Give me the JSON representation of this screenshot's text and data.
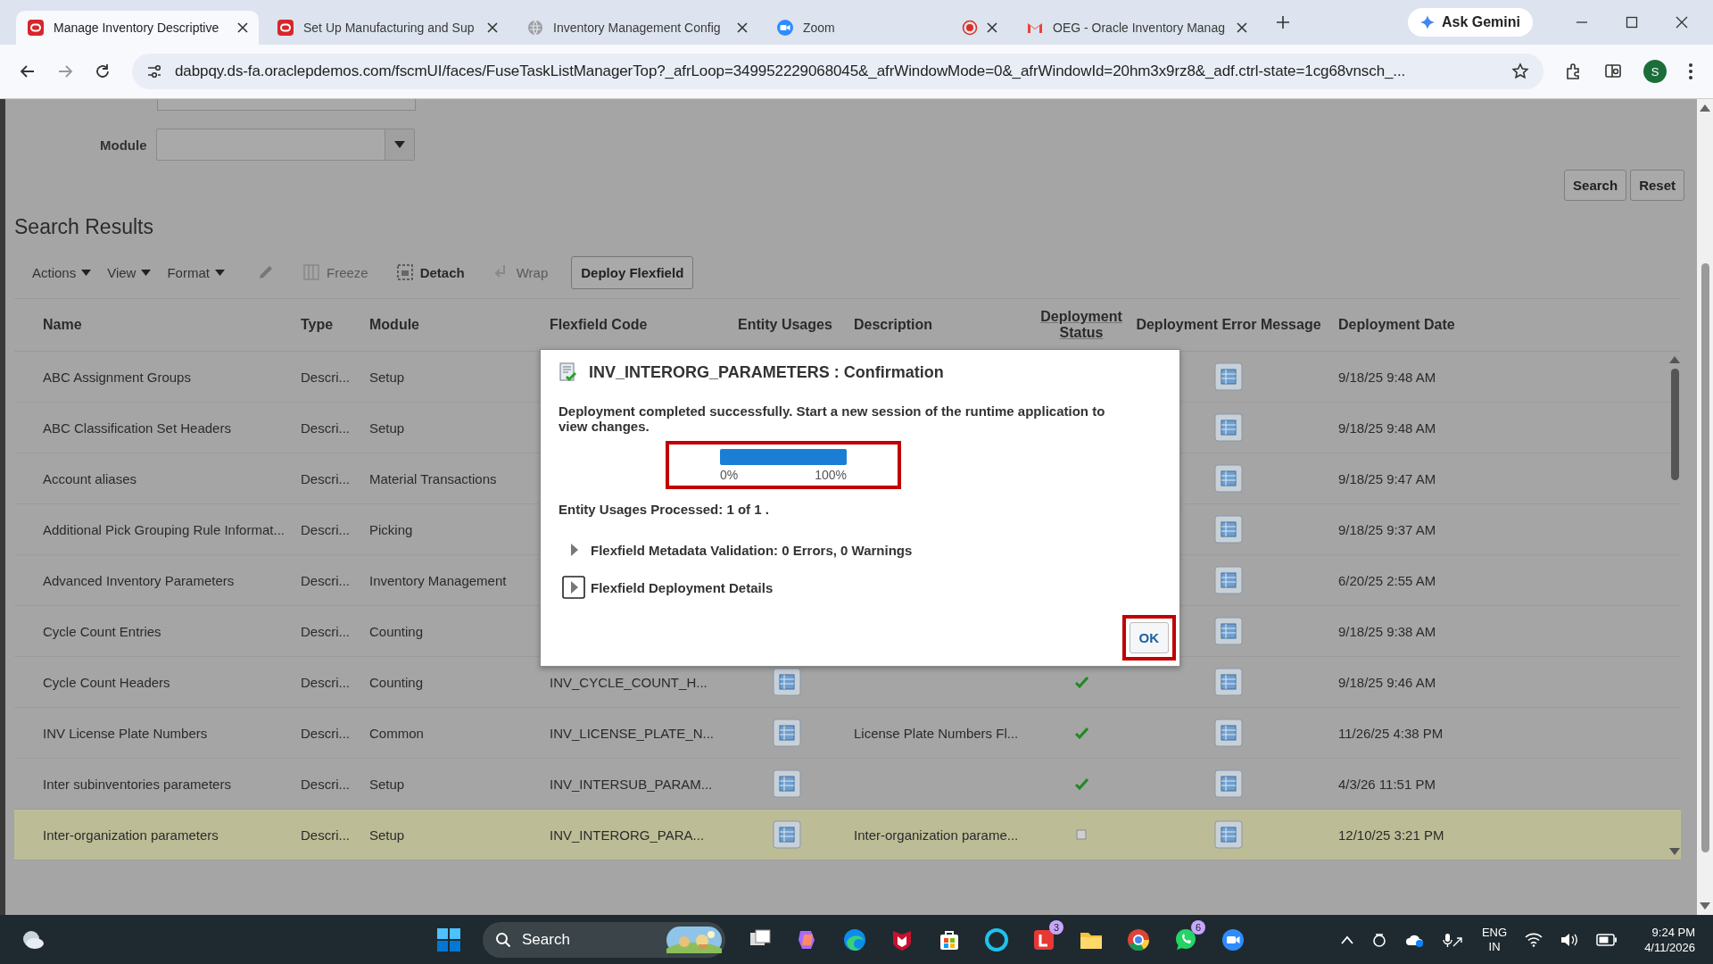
{
  "browser": {
    "tabs": [
      {
        "title": "Manage Inventory Descriptive",
        "kind": "oracle",
        "selected": true,
        "recording": false
      },
      {
        "title": "Set Up Manufacturing and Sup",
        "kind": "oracle",
        "selected": false,
        "recording": false
      },
      {
        "title": "Inventory Management Config",
        "kind": "globe",
        "selected": false,
        "recording": false
      },
      {
        "title": "Zoom",
        "kind": "zoom",
        "selected": false,
        "recording": true
      },
      {
        "title": "OEG - Oracle Inventory Manag",
        "kind": "gmail",
        "selected": false,
        "recording": false
      }
    ],
    "gemini": "Ask Gemini",
    "url": "dabpqy.ds-fa.oraclepdemos.com/fscmUI/faces/FuseTaskListManagerTop?_afrLoop=349952229068045&_afrWindowMode=0&_afrWindowId=20hm3x9rz8&_adf.ctrl-state=1cg68vnsch_...",
    "profile": "S"
  },
  "search_form": {
    "module_label": "Module",
    "buttons": [
      "Search",
      "Reset"
    ]
  },
  "results": {
    "title": "Search Results",
    "toolbar": [
      {
        "kind": "menu",
        "label": "Actions",
        "disabled": false
      },
      {
        "kind": "menu",
        "label": "View",
        "disabled": false
      },
      {
        "kind": "menu",
        "label": "Format",
        "disabled": false
      },
      {
        "kind": "edit",
        "disabled": false
      },
      {
        "kind": "freeze",
        "label": "Freeze",
        "disabled": true
      },
      {
        "kind": "detach",
        "label": "Detach",
        "disabled": false
      },
      {
        "kind": "wrap",
        "label": "Wrap",
        "disabled": true
      },
      {
        "kind": "button",
        "label": "Deploy Flexfield",
        "disabled": false
      }
    ],
    "columns": [
      "Name",
      "Type",
      "Module",
      "Flexfield Code",
      "Entity Usages",
      "Description",
      "Deployment Status",
      "Deployment Error Message",
      "Deployment Date"
    ],
    "rows": [
      {
        "name": "ABC Assignment Groups",
        "type": "Descri...",
        "module": "Setup",
        "date": "9/18/25 9:48 AM",
        "selected": false
      },
      {
        "name": "ABC Classification Set Headers",
        "type": "Descri...",
        "module": "Setup",
        "date": "9/18/25 9:48 AM",
        "selected": false
      },
      {
        "name": "Account aliases",
        "type": "Descri...",
        "module": "Material Transactions",
        "date": "9/18/25 9:47 AM",
        "selected": false
      },
      {
        "name": "Additional Pick Grouping Rule Informat...",
        "type": "Descri...",
        "module": "Picking",
        "date": "9/18/25 9:37 AM",
        "selected": false
      },
      {
        "name": "Advanced Inventory Parameters",
        "type": "Descri...",
        "module": "Inventory Management",
        "date": "6/20/25 2:55 AM",
        "selected": false
      },
      {
        "name": "Cycle Count Entries",
        "type": "Descri...",
        "module": "Counting",
        "date": "9/18/25 9:38 AM",
        "selected": false
      },
      {
        "name": "Cycle Count Headers",
        "type": "Descri...",
        "module": "Counting",
        "code": "INV_CYCLE_COUNT_H...",
        "usages": true,
        "deployed": true,
        "date": "9/18/25 9:46 AM",
        "selected": false
      },
      {
        "name": "INV License Plate Numbers",
        "type": "Descri...",
        "module": "Common",
        "code": "INV_LICENSE_PLATE_N...",
        "usages": true,
        "description": "License Plate Numbers Fl...",
        "deployed": true,
        "date": "11/26/25 4:38 PM",
        "selected": false
      },
      {
        "name": "Inter subinventories parameters",
        "type": "Descri...",
        "module": "Setup",
        "code": "INV_INTERSUB_PARAM...",
        "usages": true,
        "deployed": true,
        "date": "4/3/26 11:51 PM",
        "selected": false
      },
      {
        "name": "Inter-organization parameters",
        "type": "Descri...",
        "module": "Setup",
        "code": "INV_INTERORG_PARA...",
        "usages": true,
        "description": "Inter-organization parame...",
        "deployed": false,
        "date": "12/10/25 3:21 PM",
        "selected": true
      }
    ]
  },
  "dialog": {
    "title": "INV_INTERORG_PARAMETERS : Confirmation",
    "message": "Deployment completed successfully. Start a new session of the runtime application to view changes.",
    "progress": {
      "level": 1,
      "min_label": "0%",
      "max_label": "100%",
      "highlighted": true
    },
    "processed": "Entity Usages Processed: 1 of 1 .",
    "sections": [
      {
        "label": "Flexfield Metadata Validation: 0 Errors, 0 Warnings",
        "expanded": false,
        "focused": false
      },
      {
        "label": "Flexfield Deployment Details",
        "expanded": false,
        "focused": true
      }
    ],
    "ok": {
      "label": "OK",
      "highlighted": true
    }
  },
  "taskbar": {
    "search": "Search",
    "badges": {
      "lapp": "3",
      "whatsapp": "6"
    },
    "language": "ENG",
    "region": "IN",
    "time": "9:24 PM",
    "date": "4/11/2026"
  }
}
